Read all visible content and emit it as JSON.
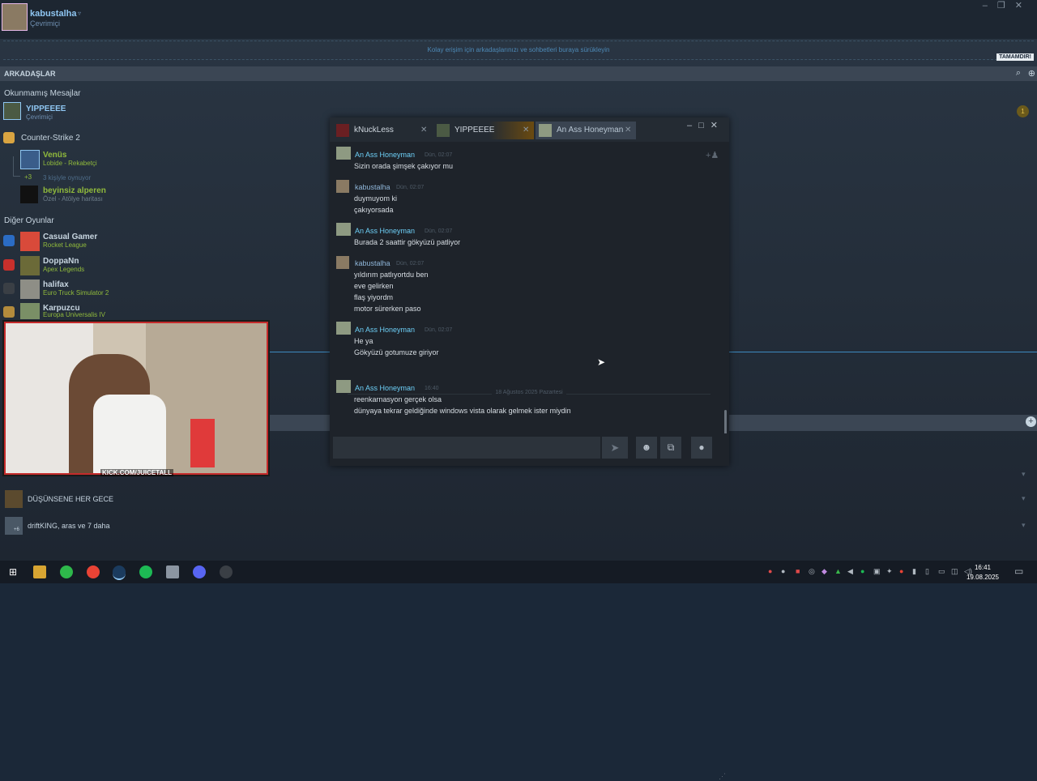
{
  "user": {
    "name": "kabustalha",
    "status": "Çevrimiçi"
  },
  "dropzone_text": "Kolay erişim için arkadaşlarınızı ve sohbetleri buraya sürükleyin",
  "done_label": "TAMAMDIR!",
  "section_title": "ARKADAŞLAR",
  "unread": {
    "title": "Okunmamış Mesajlar",
    "name": "YIPPEEEE",
    "status": "Çevrimiçi",
    "badge": "1"
  },
  "cs2": {
    "title": "Counter-Strike 2",
    "friend1": {
      "name": "Venüs",
      "detail": "Lobide - Rekabetçi"
    },
    "more_count": "+3",
    "more_text": "3 kişiyle oynuyor",
    "friend2": {
      "name": "beyinsiz alperen",
      "detail": "Özel - Atölye haritası"
    }
  },
  "other_games": {
    "title": "Diğer Oyunlar",
    "friends": [
      {
        "name": "Casual Gamer",
        "game": "Rocket League"
      },
      {
        "name": "DoppaNn",
        "game": "Apex Legends"
      },
      {
        "name": "halifax",
        "game": "Euro Truck Simulator 2"
      },
      {
        "name": "Karpuzcu",
        "game": "Europa Universalis IV"
      }
    ]
  },
  "group_chats": [
    {
      "name": "DÜŞÜNSENE HER GECE"
    },
    {
      "name": "driftKING, aras ve 7 daha",
      "count": "+6"
    }
  ],
  "chat": {
    "tabs": [
      {
        "label": "kNuckLess"
      },
      {
        "label": "YIPPEEEE"
      },
      {
        "label": "An Ass Honeyman"
      }
    ],
    "messages": [
      {
        "name": "An Ass Honeyman",
        "time": "Dün, 02:07",
        "lines": [
          "Sizin orada şimşek çakıyor mu"
        ]
      },
      {
        "name": "kabustalha",
        "time": "Dün, 02:07",
        "lines": [
          "duymuyom ki",
          "çakıyorsada"
        ]
      },
      {
        "name": "An Ass Honeyman",
        "time": "Dün, 02:07",
        "lines": [
          "Burada 2 saattir gökyüzü patliyor"
        ]
      },
      {
        "name": "kabustalha",
        "time": "Dün, 02:07",
        "lines": [
          "yıldırım patlıyortdu ben",
          "eve gelirken",
          "flaş yiyordm",
          "motor sürerken paso"
        ]
      },
      {
        "name": "An Ass Honeyman",
        "time": "Dün, 02:07",
        "lines": [
          "He ya",
          "Gökyüzü gotumuze giriyor"
        ]
      },
      {
        "name": "An Ass Honeyman",
        "time": "16:40",
        "lines": [
          "reenkarnasyon gerçek olsa",
          "dünyaya tekrar geldiğinde windows vista olarak gelmek ister miydin"
        ]
      }
    ],
    "date_separator": "18 Ağustos 2025 Pazartesi"
  },
  "overlay_text": "KICK.COM/JUICETALL",
  "clock": {
    "time": "16:41",
    "date": "19.08.2025"
  },
  "colors": {
    "online_blue": "#8fc6f2",
    "ingame_green": "#90ba3c",
    "chat_name": "#6dcff6"
  }
}
